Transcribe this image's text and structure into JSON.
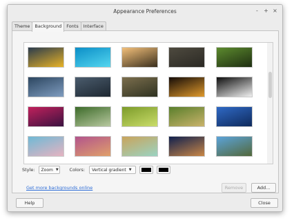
{
  "window": {
    "title": "Appearance Preferences",
    "controls": [
      "-",
      "+",
      "×"
    ]
  },
  "tabs": [
    {
      "label": "Theme",
      "active": false
    },
    {
      "label": "Background",
      "active": true
    },
    {
      "label": "Fonts",
      "active": false
    },
    {
      "label": "Interface",
      "active": false
    }
  ],
  "wallpapers": [
    {
      "name": "yellow-flowers",
      "colors": [
        "#2a3b4d",
        "#e8b326"
      ]
    },
    {
      "name": "blue-light-streaks",
      "colors": [
        "#0b8ec7",
        "#54d6ef"
      ]
    },
    {
      "name": "sunset-field",
      "colors": [
        "#f3c07a",
        "#3a2f1d"
      ]
    },
    {
      "name": "dark-pebbles",
      "colors": [
        "#4e4a3f",
        "#2b2924"
      ]
    },
    {
      "name": "green-leaf",
      "colors": [
        "#5c8a2e",
        "#1f2f12"
      ]
    },
    {
      "name": "geometric-blue",
      "colors": [
        "#2c4660",
        "#7f9cbf"
      ]
    },
    {
      "name": "stormy-sky",
      "colors": [
        "#4b5c6d",
        "#1d2731"
      ]
    },
    {
      "name": "fence-meadow",
      "colors": [
        "#7b6e4d",
        "#2f3221"
      ]
    },
    {
      "name": "candle",
      "colors": [
        "#150c08",
        "#e09a2c"
      ]
    },
    {
      "name": "white-flower-dark",
      "colors": [
        "#0e0e0e",
        "#f0f0f0"
      ]
    },
    {
      "name": "purple-abstract",
      "colors": [
        "#c1215c",
        "#3a1240"
      ]
    },
    {
      "name": "garden-path",
      "colors": [
        "#3d6b2a",
        "#b8c8a0"
      ]
    },
    {
      "name": "green-blossoms",
      "colors": [
        "#7c9b2a",
        "#cadd6a"
      ]
    },
    {
      "name": "rolling-meadow",
      "colors": [
        "#5a7f2c",
        "#cab36b"
      ]
    },
    {
      "name": "coastal-rocks",
      "colors": [
        "#2f69c5",
        "#0f2a5c"
      ]
    },
    {
      "name": "pastel-blur",
      "colors": [
        "#6fb9d5",
        "#e6b3c1"
      ]
    },
    {
      "name": "tiled-wall",
      "colors": [
        "#b2548c",
        "#e0a06a"
      ]
    },
    {
      "name": "golden-bokeh",
      "colors": [
        "#c9a45c",
        "#9ad3c2"
      ]
    },
    {
      "name": "lake-sunset",
      "colors": [
        "#10204e",
        "#c98746"
      ]
    },
    {
      "name": "valley-sky",
      "colors": [
        "#5ba3d9",
        "#53683b"
      ]
    }
  ],
  "style": {
    "label": "Style:",
    "value": "Zoom"
  },
  "colors": {
    "label": "Colors:",
    "value": "Vertical gradient",
    "primary": "#000000",
    "secondary": "#000000"
  },
  "link": "Get more backgrounds online",
  "buttons": {
    "remove": "Remove",
    "add": "Add...",
    "help": "Help",
    "close": "Close"
  }
}
